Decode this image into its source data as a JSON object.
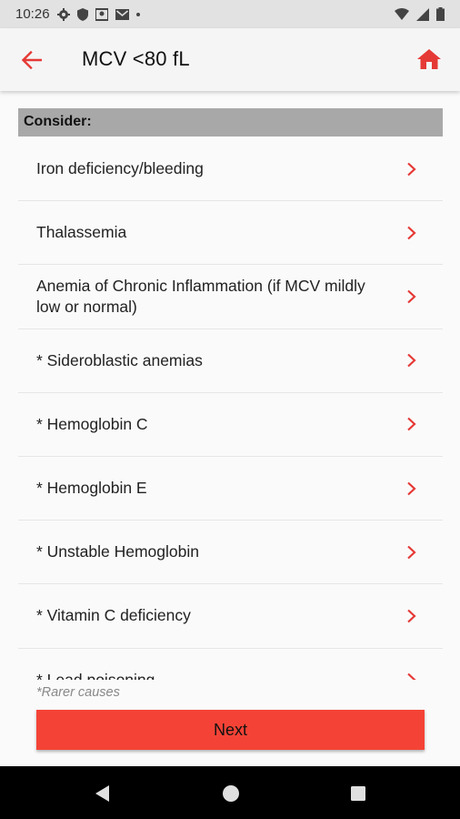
{
  "status_bar": {
    "time": "10:26",
    "left_icons": [
      "gear-icon",
      "shield-icon",
      "location-icon",
      "gmail-icon",
      "dot-icon"
    ],
    "right_icons": [
      "wifi-icon",
      "signal-icon",
      "battery-icon"
    ]
  },
  "app_bar": {
    "title": "MCV <80 fL",
    "back_icon": "arrow-left-icon",
    "home_icon": "home-icon",
    "accent_color": "#e53935"
  },
  "section": {
    "header": "Consider:"
  },
  "list": {
    "items": [
      {
        "label": "Iron deficiency/bleeding"
      },
      {
        "label": "Thalassemia"
      },
      {
        "label": "Anemia of Chronic Inflammation (if MCV mildly low or normal)"
      },
      {
        "label": "* Sideroblastic anemias"
      },
      {
        "label": "* Hemoglobin C"
      },
      {
        "label": "* Hemoglobin E"
      },
      {
        "label": "* Unstable Hemoglobin"
      },
      {
        "label": "* Vitamin C deficiency"
      },
      {
        "label": "* Lead poisoning"
      }
    ],
    "chevron_icon": "chevron-right-icon"
  },
  "footnote": "*Rarer causes",
  "next_button": {
    "label": "Next",
    "color": "#f44336"
  },
  "nav_bar": {
    "icons": [
      "back-triangle-icon",
      "home-circle-icon",
      "recents-square-icon"
    ]
  }
}
